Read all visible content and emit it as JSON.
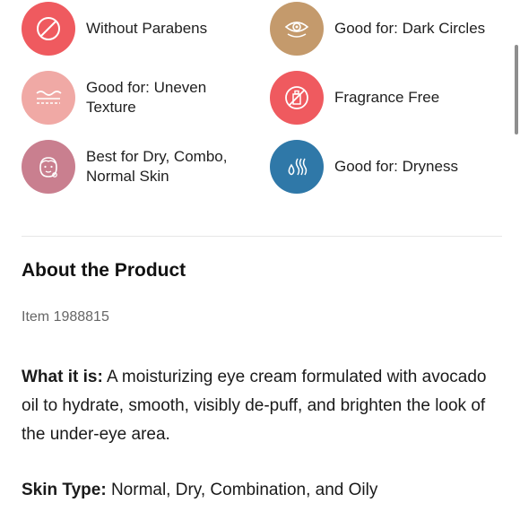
{
  "highlights": [
    {
      "label": "Without Parabens",
      "icon": "no-parabens-icon",
      "color": "#ef5a5f"
    },
    {
      "label": "Good for: Dark Circles",
      "icon": "eye-icon",
      "color": "#c49a6c"
    },
    {
      "label": "Good for: Uneven Texture",
      "icon": "texture-icon",
      "color": "#f0a9a5"
    },
    {
      "label": "Fragrance Free",
      "icon": "no-fragrance-icon",
      "color": "#ef5a5f"
    },
    {
      "label": "Best for Dry, Combo, Normal Skin",
      "icon": "face-icon",
      "color": "#c97f8f"
    },
    {
      "label": "Good for: Dryness",
      "icon": "dryness-icon",
      "color": "#2f78a8"
    }
  ],
  "about": {
    "title": "About the Product",
    "item_number": "Item 1988815",
    "what_it_is_label": "What it is:",
    "what_it_is_text": " A moisturizing eye cream formulated with avocado oil to hydrate, smooth, visibly de-puff, and brighten the look of the under-eye area.",
    "skin_type_label": "Skin Type:",
    "skin_type_text": " Normal, Dry, Combination, and Oily"
  }
}
